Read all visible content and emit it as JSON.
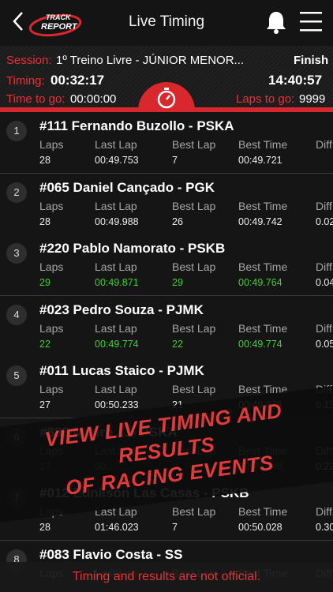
{
  "header": {
    "title": "Live Timing",
    "logo_line1": "TRACK",
    "logo_line2": "REPORT"
  },
  "session": {
    "session_label": "Session:",
    "session_name": "1º Treino Livre - JÚNIOR MENOR...",
    "status": "Finish",
    "timing_label": "Timing:",
    "timing_value": "00:32:17",
    "clock": "14:40:57",
    "time_to_go_label": "Time to go:",
    "time_to_go_value": "00:00:00",
    "laps_to_go_label": "Laps to go:",
    "laps_to_go_value": "9999"
  },
  "columns": {
    "laps": "Laps",
    "last_lap": "Last Lap",
    "best_lap": "Best Lap",
    "best_time": "Best Time",
    "diff": "Diff"
  },
  "rows": [
    {
      "pos": "1",
      "name": "#111 Fernando Buzollo - PSKA",
      "laps": "28",
      "last": "00:49.753",
      "best_lap": "7",
      "best_time": "00:49.721",
      "diff": "",
      "green": false
    },
    {
      "pos": "2",
      "name": "#065 Daniel Cançado - PGK",
      "laps": "28",
      "last": "00:49.988",
      "best_lap": "26",
      "best_time": "00:49.742",
      "diff": "0.02",
      "green": false
    },
    {
      "pos": "3",
      "name": "#220 Pablo Namorato - PSKB",
      "laps": "29",
      "last": "00:49.871",
      "best_lap": "29",
      "best_time": "00:49.764",
      "diff": "0.04",
      "green": true
    },
    {
      "pos": "4",
      "name": "#023 Pedro Souza - PJMK",
      "laps": "22",
      "last": "00:49.774",
      "best_lap": "22",
      "best_time": "00:49.774",
      "diff": "0.05",
      "green": true
    },
    {
      "pos": "5",
      "name": "#011 Lucas Staico - PJMK",
      "laps": "27",
      "last": "00:50.233",
      "best_lap": "21",
      "best_time": "00:49.878",
      "diff": "0.15",
      "green": false
    },
    {
      "pos": "6",
      "name": "#888 Mauro ... - PSKA",
      "laps": "17",
      "last": "00:...",
      "best_lap": "",
      "best_time": "00:49.948",
      "diff": "0.22",
      "green": true
    },
    {
      "pos": "7",
      "name": "#012 Ednilson Las Casas - PSKB",
      "laps": "28",
      "last": "01:46.023",
      "best_lap": "7",
      "best_time": "00:50.028",
      "diff": "0.30",
      "green": false
    },
    {
      "pos": "8",
      "name": "#083 Flavio Costa - SS",
      "laps": "",
      "last": "",
      "best_lap": "",
      "best_time": "",
      "diff": "",
      "green": false
    }
  ],
  "promo_line1": "VIEW LIVE TIMING AND RESULTS",
  "promo_line2": "OF RACING EVENTS",
  "footer": "Timing and results are not official.",
  "colors": {
    "accent": "#d9272e",
    "green": "#3ed22a",
    "background": "#111111"
  }
}
